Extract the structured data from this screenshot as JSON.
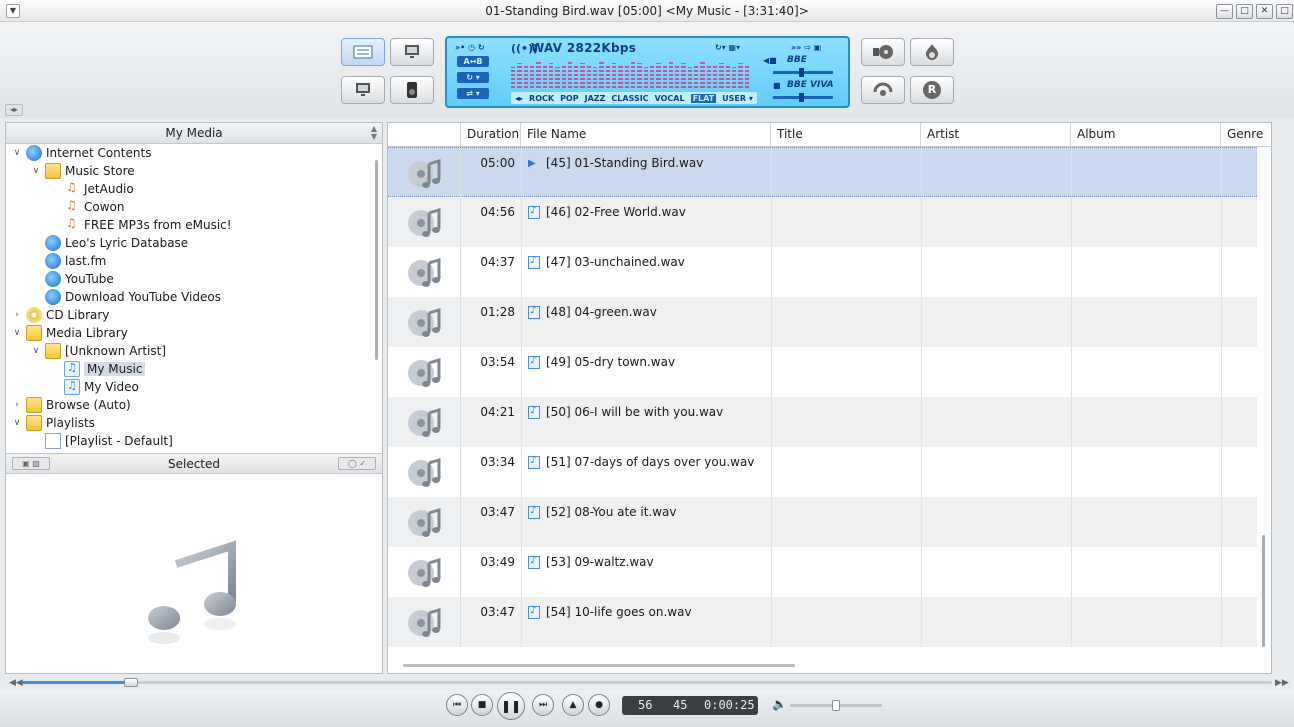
{
  "window": {
    "title": "01-Standing Bird.wav  [05:00]   <My Music - [3:31:40]>"
  },
  "lcd": {
    "format": "WAV  2822Kbps",
    "ab_label": "A↔B",
    "eq_presets": [
      "ROCK",
      "POP",
      "JAZZ",
      "CLASSIC",
      "VOCAL",
      "FLAT",
      "USER ▾"
    ],
    "selected_preset": "FLAT",
    "effect_top": "BBE",
    "effect_bottom": "BBE VIVA",
    "accent_color": "#1a63b8",
    "eq_levels": [
      0.7,
      0.85,
      0.8,
      0.75,
      0.9,
      0.8,
      0.85,
      0.7,
      0.8,
      0.9,
      0.75,
      0.85,
      0.8,
      0.7,
      0.9,
      0.8,
      0.85,
      0.75,
      0.8,
      0.9,
      0.85,
      0.7,
      0.8,
      0.85,
      0.75,
      0.9,
      0.8,
      0.85,
      0.7,
      0.8,
      0.9,
      0.75,
      0.8,
      0.85,
      0.8,
      0.7,
      0.85,
      0.8
    ]
  },
  "right_buttons": {
    "record_label": "R"
  },
  "left_panel": {
    "header": "My Media",
    "selected_header": "Selected",
    "tree": [
      {
        "label": "Internet Contents",
        "icon": "globe-icon",
        "level": 0,
        "expander": "⌵",
        "twist": "down"
      },
      {
        "label": "Music Store",
        "icon": "folder-icon",
        "level": 1,
        "twist": "down"
      },
      {
        "label": "JetAudio",
        "icon": "music-store-icon",
        "level": 2,
        "twist": ""
      },
      {
        "label": "Cowon",
        "icon": "music-store-icon",
        "level": 2,
        "twist": ""
      },
      {
        "label": "FREE MP3s from eMusic!",
        "icon": "music-store-icon",
        "level": 2,
        "twist": ""
      },
      {
        "label": "Leo's Lyric Database",
        "icon": "globe-icon",
        "level": 1,
        "twist": ""
      },
      {
        "label": "last.fm",
        "icon": "globe-icon",
        "level": 1,
        "twist": ""
      },
      {
        "label": "YouTube",
        "icon": "globe-icon",
        "level": 1,
        "twist": ""
      },
      {
        "label": "Download YouTube Videos",
        "icon": "globe-icon",
        "level": 1,
        "twist": ""
      },
      {
        "label": "CD Library",
        "icon": "cd-icon",
        "level": 0,
        "twist": "right"
      },
      {
        "label": "Media Library",
        "icon": "folder-icon",
        "level": 0,
        "twist": "down"
      },
      {
        "label": "[Unknown Artist]",
        "icon": "folder-icon",
        "level": 1,
        "twist": "down"
      },
      {
        "label": "My Music",
        "icon": "music-note-icon",
        "level": 2,
        "twist": "",
        "selected": true
      },
      {
        "label": "My Video",
        "icon": "music-note-icon",
        "level": 2,
        "twist": ""
      },
      {
        "label": "Browse (Auto)",
        "icon": "folder-icon",
        "level": 0,
        "twist": "right"
      },
      {
        "label": "Playlists",
        "icon": "folder-icon",
        "level": 0,
        "twist": "down"
      },
      {
        "label": "[Playlist - Default]",
        "icon": "playlist-icon",
        "level": 1,
        "twist": ""
      }
    ]
  },
  "list": {
    "columns": [
      "Duration",
      "File Name",
      "Title",
      "Artist",
      "Album",
      "Genre"
    ],
    "rows": [
      {
        "duration": "05:00",
        "file": "[45] 01-Standing Bird.wav",
        "playing": true
      },
      {
        "duration": "04:56",
        "file": "[46] 02-Free World.wav"
      },
      {
        "duration": "04:37",
        "file": "[47] 03-unchained.wav"
      },
      {
        "duration": "01:28",
        "file": "[48] 04-green.wav"
      },
      {
        "duration": "03:54",
        "file": "[49] 05-dry town.wav"
      },
      {
        "duration": "04:21",
        "file": "[50] 06-I will be with you.wav"
      },
      {
        "duration": "03:34",
        "file": "[51] 07-days of days over you.wav"
      },
      {
        "duration": "03:47",
        "file": "[52] 08-You ate it.wav"
      },
      {
        "duration": "03:49",
        "file": "[53] 09-waltz.wav"
      },
      {
        "duration": "03:47",
        "file": "[54] 10-life goes on.wav"
      }
    ]
  },
  "player": {
    "counter_a": "56",
    "counter_b": "45",
    "elapsed": "0:00:25",
    "seek_fraction": 0.087,
    "volume_fraction": 0.5
  }
}
